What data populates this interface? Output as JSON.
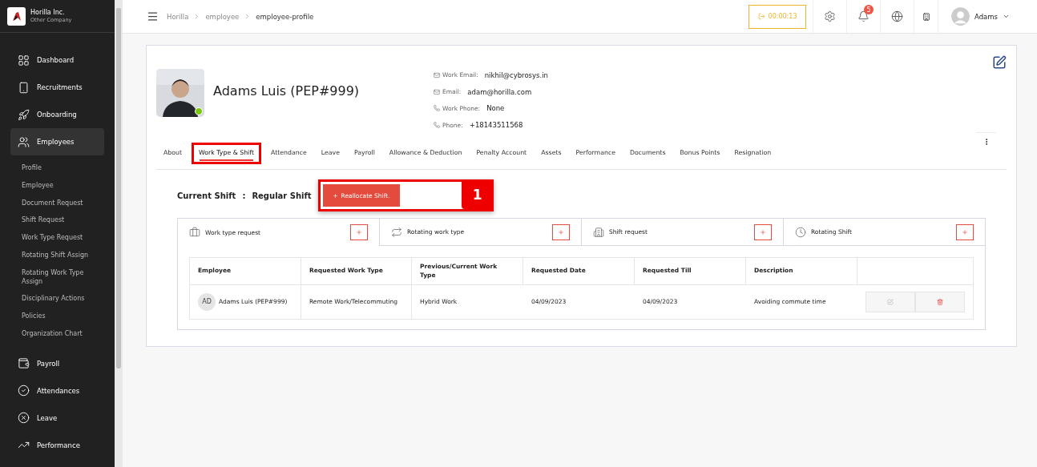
{
  "sidebar": {
    "company": {
      "name": "Horilla Inc.",
      "subtitle": "Other Company"
    },
    "items": [
      {
        "label": "Dashboard",
        "selected": false
      },
      {
        "label": "Recruitments",
        "selected": false
      },
      {
        "label": "Onboarding",
        "selected": false
      },
      {
        "label": "Employees",
        "selected": true,
        "children": [
          {
            "label": "Profile"
          },
          {
            "label": "Employee"
          },
          {
            "label": "Document Request"
          },
          {
            "label": "Shift Request"
          },
          {
            "label": "Work Type Request"
          },
          {
            "label": "Rotating Shift Assign"
          },
          {
            "label": "Rotating Work Type Assign"
          },
          {
            "label": "Disciplinary Actions"
          },
          {
            "label": "Policies"
          },
          {
            "label": "Organization Chart"
          }
        ]
      },
      {
        "label": "Payroll",
        "selected": false
      },
      {
        "label": "Attendances",
        "selected": false
      },
      {
        "label": "Leave",
        "selected": false
      },
      {
        "label": "Performance",
        "selected": false
      }
    ]
  },
  "header": {
    "breadcrumbs": [
      "Horilla",
      "employee",
      "employee-profile"
    ],
    "timer": "00:00:13",
    "notification_count": "5",
    "user": "Adams"
  },
  "profile": {
    "name": "Adams Luis (PEP#999)",
    "online": true,
    "contacts": [
      {
        "kind": "email",
        "label": "Work Email:",
        "value": "nikhil@cybrosys.in"
      },
      {
        "kind": "email",
        "label": "Email:",
        "value": "adam@horilla.com"
      },
      {
        "kind": "phone",
        "label": "Work Phone:",
        "value": "None"
      },
      {
        "kind": "phone",
        "label": "Phone:",
        "value": "+18143511568"
      }
    ]
  },
  "tabs": [
    {
      "label": "About",
      "selected": false,
      "highlighted": false
    },
    {
      "label": "Work Type & Shift",
      "selected": true,
      "highlighted": true
    },
    {
      "label": "Attendance",
      "selected": false,
      "highlighted": false
    },
    {
      "label": "Leave",
      "selected": false,
      "highlighted": false
    },
    {
      "label": "Payroll",
      "selected": false,
      "highlighted": false
    },
    {
      "label": "Allowance & Deduction",
      "selected": false,
      "highlighted": false
    },
    {
      "label": "Penalty Account",
      "selected": false,
      "highlighted": false
    },
    {
      "label": "Assets",
      "selected": false,
      "highlighted": false
    },
    {
      "label": "Performance",
      "selected": false,
      "highlighted": false
    },
    {
      "label": "Documents",
      "selected": false,
      "highlighted": false
    },
    {
      "label": "Bonus Points",
      "selected": false,
      "highlighted": false
    },
    {
      "label": "Resignation",
      "selected": false,
      "highlighted": false
    }
  ],
  "current_shift": {
    "label": "Current Shift",
    "separator": ":",
    "value": "Regular Shift",
    "button": "Reallocate Shift.",
    "highlighted": true,
    "annotation": "1"
  },
  "sub_tabs": [
    {
      "label": "Work type request",
      "selected": true
    },
    {
      "label": "Rotating work type",
      "selected": false
    },
    {
      "label": "Shift request",
      "selected": false
    },
    {
      "label": "Rotating Shift",
      "selected": false
    }
  ],
  "table": {
    "columns": [
      "Employee",
      "Requested Work Type",
      "Previous/Current Work Type",
      "Requested Date",
      "Requested Till",
      "Description"
    ],
    "rows": [
      {
        "initials": "AD",
        "employee": "Adams Luis (PEP#999)",
        "requested_work_type": "Remote Work/Telecommuting",
        "previous_work_type": "Hybrid Work",
        "requested_date": "04/09/2023",
        "requested_till": "04/09/2023",
        "description": "Avoiding commute time"
      }
    ]
  }
}
